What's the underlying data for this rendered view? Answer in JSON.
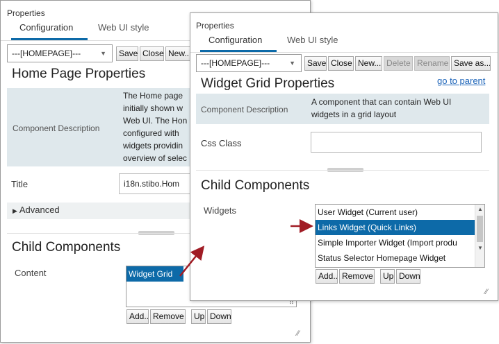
{
  "back_panel": {
    "title": "Properties",
    "tabs": [
      {
        "label": "Configuration"
      },
      {
        "label": "Web UI style"
      }
    ],
    "selector_value": "---[HOMEPAGE]---",
    "buttons": {
      "save": "Save",
      "close": "Close",
      "new": "New..."
    },
    "heading": "Home Page Properties",
    "component_description_label": "Component Description",
    "component_description_lines": [
      "The Home page",
      "initially shown w",
      "Web UI. The Hon",
      "configured with",
      "widgets providin",
      "overview of selec"
    ],
    "title_label": "Title",
    "title_value": "i18n.stibo.Hom",
    "advanced_label": "Advanced",
    "child_components_heading": "Child Components",
    "content_label": "Content",
    "content_items": [
      "Widget Grid"
    ],
    "list_buttons": {
      "add": "Add..",
      "remove": "Remove",
      "up": "Up",
      "down": "Down"
    }
  },
  "front_panel": {
    "title": "Properties",
    "tabs": [
      {
        "label": "Configuration"
      },
      {
        "label": "Web UI style"
      }
    ],
    "selector_value": "---[HOMEPAGE]---",
    "buttons": {
      "save": "Save",
      "close": "Close",
      "new": "New...",
      "delete": "Delete",
      "rename": "Rename",
      "save_as": "Save as..."
    },
    "heading": "Widget Grid Properties",
    "go_to_parent": "go to parent",
    "component_description_label": "Component Description",
    "component_description_lines": [
      "A component that can contain Web UI",
      "widgets in a grid layout"
    ],
    "css_class_label": "Css Class",
    "css_class_value": "",
    "child_components_heading": "Child Components",
    "widgets_label": "Widgets",
    "widgets_items": [
      "User Widget (Current user)",
      "Links Widget (Quick Links)",
      "Simple Importer Widget (Import produ",
      "Status Selector Homepage Widget"
    ],
    "widgets_selected_index": 1,
    "list_buttons": {
      "add": "Add..",
      "remove": "Remove",
      "up": "Up",
      "down": "Down"
    }
  },
  "colors": {
    "accent": "#0d6aa8",
    "annotation_arrow": "#a01c25",
    "description_band": "#dfe8ec",
    "link": "#1b63b8"
  },
  "icons": [
    "dropdown-caret-icon",
    "expand-triangle-icon",
    "resize-grip-icon",
    "scroll-up-icon",
    "scroll-down-icon",
    "annotation-arrow-icon"
  ]
}
